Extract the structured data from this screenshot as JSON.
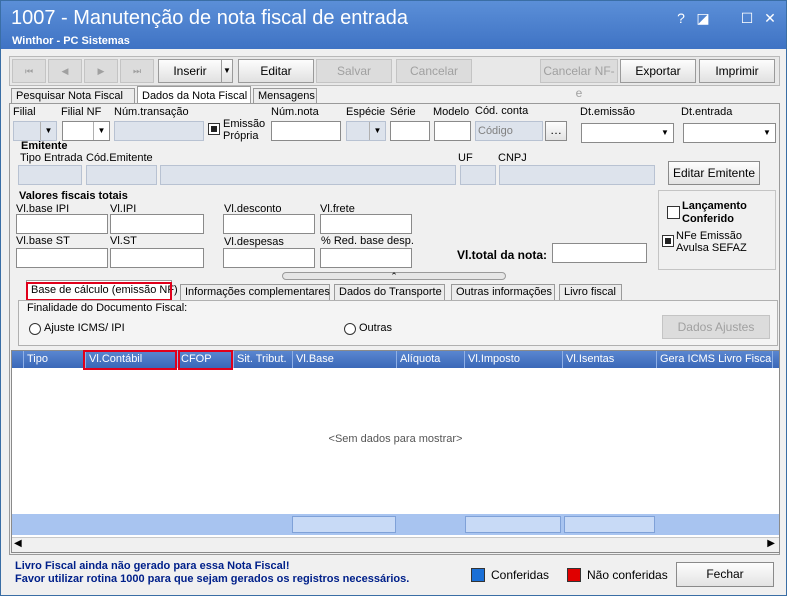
{
  "window": {
    "title": "1007 - Manutenção de nota fiscal de entrada",
    "subtitle": "Winthor - PC Sistemas",
    "controls": [
      "?",
      "◪",
      "☐",
      "✕"
    ]
  },
  "toolbar": {
    "nav": [
      "⏮",
      "◀",
      "▶",
      "⏭"
    ],
    "inserir": "Inserir",
    "editar": "Editar",
    "salvar": "Salvar",
    "cancelar": "Cancelar",
    "cancelar_nfe": "Cancelar NF-e",
    "exportar": "Exportar",
    "imprimir": "Imprimir"
  },
  "tabs": [
    "Pesquisar Nota Fiscal",
    "Dados da Nota Fiscal",
    "Mensagens"
  ],
  "fields": {
    "filial": "Filial",
    "filial_nf": "Filial NF",
    "num_transacao": "Núm.transação",
    "emissao_propria": "Emissão Própria",
    "num_nota": "Núm.nota",
    "especie": "Espécie",
    "serie": "Série",
    "modelo": "Modelo",
    "cod_conta": "Cód. conta",
    "codigo_placeholder": "Código",
    "dt_emissao": "Dt.emissão",
    "dt_entrada": "Dt.entrada"
  },
  "emitente": {
    "title": "Emitente",
    "tipo_entrada": "Tipo Entrada",
    "cod_emitente": "Cód.Emitente",
    "uf": "UF",
    "cnpj": "CNPJ",
    "editar_button": "Editar Emitente"
  },
  "valores": {
    "title": "Valores fiscais totais",
    "vl_base_ipi": "Vl.base IPI",
    "vl_ipi": "Vl.IPI",
    "vl_desconto": "Vl.desconto",
    "vl_frete": "Vl.frete",
    "vl_base_st": "Vl.base ST",
    "vl_st": "Vl.ST",
    "vl_despesas": "Vl.despesas",
    "red_base": "% Red. base desp.",
    "vl_total": "Vl.total da nota:"
  },
  "side": {
    "lancamento": "Lançamento Conferido",
    "nfe_avulsa": "NFe Emissão Avulsa SEFAZ"
  },
  "subtabs": [
    "Base de cálculo (emissão NF)",
    "Informações complementares",
    "Dados do Transporte",
    "Outras informações",
    "Livro fiscal"
  ],
  "finalidade": {
    "label": "Finalidade do Documento Fiscal:",
    "opt1": "Ajuste ICMS/ IPI",
    "opt2": "Outras",
    "dados_ajustes": "Dados Ajustes"
  },
  "grid": {
    "columns": [
      "Tipo",
      "Vl.Contábil",
      "CFOP",
      "Sit. Tribut.",
      "Vl.Base",
      "Alíquota",
      "Vl.Imposto",
      "Vl.Isentas",
      "Gera ICMS Livro Fiscal"
    ],
    "empty": "<Sem dados para mostrar>"
  },
  "footer": {
    "msg1": "Livro Fiscal ainda não gerado para essa Nota Fiscal!",
    "msg2": "Favor utilizar rotina 1000 para que sejam gerados os registros necessários.",
    "conferidas": "Conferidas",
    "nao_conferidas": "Não conferidas",
    "fechar": "Fechar",
    "color_conferidas": "#1a6fd6",
    "color_nao": "#e00000"
  }
}
